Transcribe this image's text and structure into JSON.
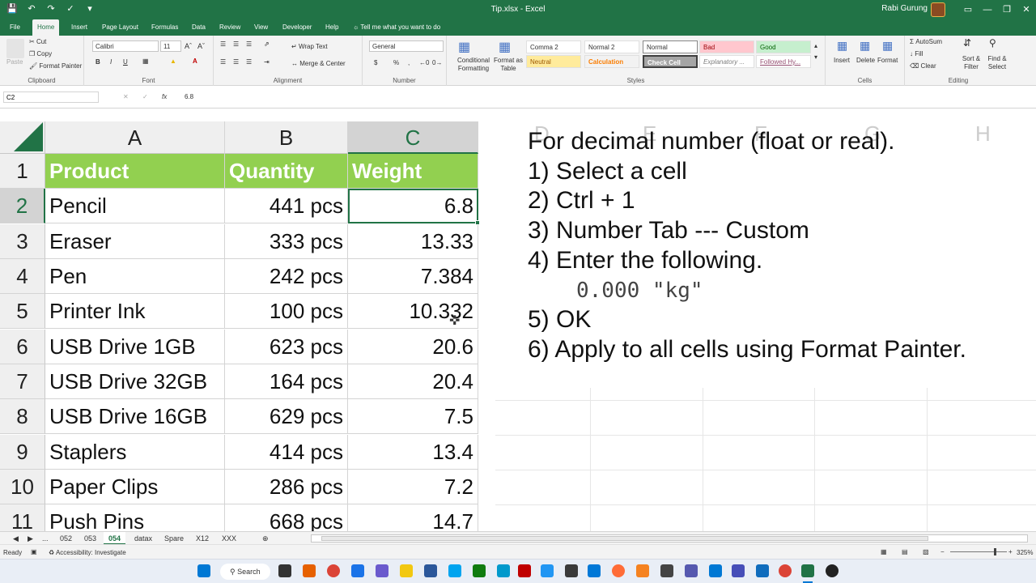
{
  "window": {
    "title": "Tip.xlsx - Excel",
    "user": "Rabi Gurung"
  },
  "ribbon_tabs": [
    "File",
    "Home",
    "Insert",
    "Page Layout",
    "Formulas",
    "Data",
    "Review",
    "View",
    "Developer",
    "Help"
  ],
  "tell_me": "Tell me what you want to do",
  "ribbon": {
    "clipboard": {
      "paste": "Paste",
      "cut": "Cut",
      "copy": "Copy",
      "format_painter": "Format Painter",
      "label": "Clipboard"
    },
    "font": {
      "name": "Calibri",
      "size": "11",
      "bold": "B",
      "italic": "I",
      "underline": "U",
      "label": "Font"
    },
    "alignment": {
      "wrap": "Wrap Text",
      "merge": "Merge & Center",
      "label": "Alignment"
    },
    "number": {
      "format": "General",
      "currency": "$",
      "percent": "%",
      "comma": ",",
      "label": "Number"
    },
    "styles": {
      "conditional": "Conditional Formatting",
      "format_table": "Format as Table",
      "cells": [
        "Comma 2",
        "Normal 2",
        "Normal",
        "Bad",
        "Good",
        "Neutral",
        "Calculation",
        "Check Cell",
        "Explanatory ...",
        "Followed Hy..."
      ],
      "label": "Styles"
    },
    "cells": {
      "insert": "Insert",
      "delete": "Delete",
      "format": "Format",
      "label": "Cells"
    },
    "editing": {
      "autosum": "AutoSum",
      "fill": "Fill",
      "clear": "Clear",
      "sort": "Sort & Filter",
      "find": "Find & Select",
      "label": "Editing"
    }
  },
  "formula_bar": {
    "name_box": "C2",
    "fx": "fx",
    "value": "6.8"
  },
  "columns": [
    "A",
    "B",
    "C"
  ],
  "ghost_columns": [
    "D",
    "E",
    "F",
    "G",
    "H"
  ],
  "rows": [
    {
      "n": "1",
      "a": "Product",
      "b": "Quantity",
      "c": "Weight"
    },
    {
      "n": "2",
      "a": "Pencil",
      "b": "441 pcs",
      "c": "6.8"
    },
    {
      "n": "3",
      "a": "Eraser",
      "b": "333 pcs",
      "c": "13.33"
    },
    {
      "n": "4",
      "a": "Pen",
      "b": "242 pcs",
      "c": "7.384"
    },
    {
      "n": "5",
      "a": "Printer Ink",
      "b": "100 pcs",
      "c": "10.332"
    },
    {
      "n": "6",
      "a": "USB Drive 1GB",
      "b": "623 pcs",
      "c": "20.6"
    },
    {
      "n": "7",
      "a": "USB Drive 32GB",
      "b": "164 pcs",
      "c": "20.4"
    },
    {
      "n": "8",
      "a": "USB Drive 16GB",
      "b": "629 pcs",
      "c": "7.5"
    },
    {
      "n": "9",
      "a": "Staplers",
      "b": "414 pcs",
      "c": "13.4"
    },
    {
      "n": "10",
      "a": "Paper Clips",
      "b": "286 pcs",
      "c": "7.2"
    },
    {
      "n": "11",
      "a": "Push Pins",
      "b": "668 pcs",
      "c": "14.7"
    }
  ],
  "instructions": [
    "For decimal number (float or real).",
    "1) Select a cell",
    "2) Ctrl + 1",
    "3) Number Tab --- Custom",
    "4) Enter the following.",
    "0.000 \"kg\"",
    "5) OK",
    "6) Apply to all cells using Format Painter."
  ],
  "sheet_tabs": [
    "...",
    "052",
    "053",
    "054",
    "datax",
    "Spare",
    "X12",
    "XXX"
  ],
  "active_sheet": "054",
  "status": {
    "ready": "Ready",
    "accessibility": "Accessibility: Investigate",
    "zoom": "325%"
  },
  "taskbar": {
    "search": "Search"
  },
  "colors": {
    "excel_green": "#217346",
    "header_fill": "#92d050"
  }
}
